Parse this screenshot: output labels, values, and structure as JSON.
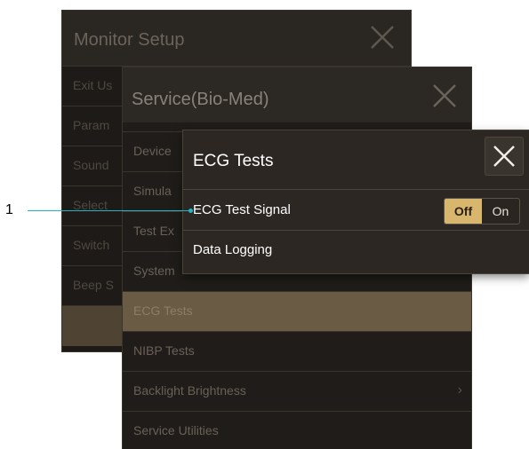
{
  "monitor_setup": {
    "title": "Monitor Setup",
    "items": [
      {
        "label": "Exit Us"
      },
      {
        "label": "Param"
      },
      {
        "label": "Sound"
      },
      {
        "label": "Select"
      },
      {
        "label": "Switch"
      },
      {
        "label": "Beep S"
      },
      {
        "label": "",
        "selected": true
      }
    ]
  },
  "service_biomed": {
    "title": "Service(Bio-Med)",
    "items": [
      {
        "label": "Device"
      },
      {
        "label": "Simula"
      },
      {
        "label": "Test Ex"
      },
      {
        "label": "System"
      },
      {
        "label": "ECG Tests",
        "selected": true
      },
      {
        "label": "NIBP Tests"
      },
      {
        "label": "Backlight Brightness"
      },
      {
        "label": "Service Utilities"
      }
    ]
  },
  "ecg_tests": {
    "title": "ECG Tests",
    "rows": [
      {
        "label": "ECG Test Signal",
        "toggle": {
          "off": "Off",
          "on": "On",
          "selected": "off"
        }
      },
      {
        "label": "Data Logging"
      }
    ]
  },
  "callout": {
    "number": "1",
    "color": "#20b6c6"
  },
  "colors": {
    "toggle_active": "#d9b66e",
    "panel_bg": "#2c2723",
    "selected_row": "#6a5b45"
  },
  "icons": {
    "close": "close-icon"
  }
}
